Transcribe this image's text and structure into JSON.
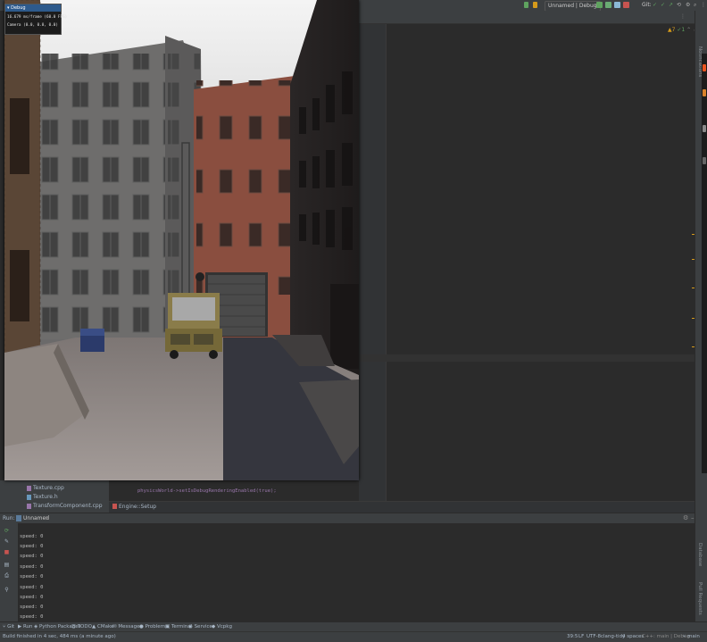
{
  "toolbar": {
    "run_config": "Unnamed | Debug",
    "git_label": "Git:"
  },
  "notifications": {
    "warnings": "▲7",
    "weak": "✓1"
  },
  "right_sidebar": {
    "top_label": "Notifications",
    "mid_label": "Database",
    "low_label": "Pull Requests"
  },
  "debug_window": {
    "title": "Debug",
    "frame_stats": "16.679 ms/frame (60.0 FPS)",
    "camera": "Camera (0.0, 0.0, 0.0)"
  },
  "project_tree": {
    "items": [
      "Texture.cpp",
      "Texture.h",
      "TransformComponent.cpp"
    ]
  },
  "code": {
    "lines": [
      "physicsWorld->setIsDebugRenderingEnabled(true);"
    ]
  },
  "breadcrumb": {
    "label": "Engine::Setup"
  },
  "run_panel": {
    "label": "Run:",
    "tab": "Unnamed",
    "output": [
      "speed: 0",
      "speed: 0",
      "speed: 0",
      "speed: 0",
      "speed: 0",
      "speed: 0",
      "speed: 0",
      "speed: 0",
      "speed: 0"
    ]
  },
  "bottom_tools": [
    {
      "icon": "git-icon",
      "label": "Git"
    },
    {
      "icon": "run-icon",
      "label": "Run"
    },
    {
      "icon": "python-icon",
      "label": "Python Packages"
    },
    {
      "icon": "todo-icon",
      "label": "TODO"
    },
    {
      "icon": "cmake-icon",
      "label": "CMake"
    },
    {
      "icon": "messages-icon",
      "label": "Messages"
    },
    {
      "icon": "problems-icon",
      "label": "Problems"
    },
    {
      "icon": "terminal-icon",
      "label": "Terminal"
    },
    {
      "icon": "services-icon",
      "label": "Services"
    },
    {
      "icon": "vcpkg-icon",
      "label": "Vcpkg"
    }
  ],
  "status": {
    "message": "Build finished in 4 sec, 484 ms (a minute ago)",
    "position": "39:5",
    "line_ending": "LF",
    "encoding": "UTF-8",
    "tidy": "clang-tidy",
    "indent": "4 spaces",
    "context": "C++: main | Debug",
    "branch": "main"
  },
  "colors": {
    "accent_blue": "#2d5a8c",
    "warning": "#d59a1b",
    "ok_green": "#5fa35f"
  }
}
